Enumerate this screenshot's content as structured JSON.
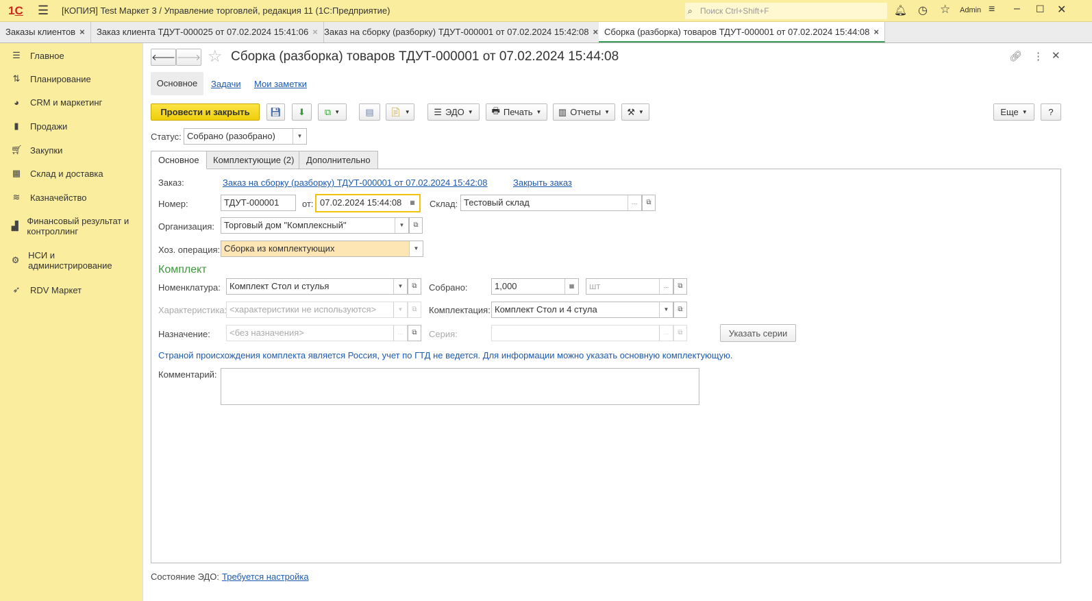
{
  "app": {
    "title": "[КОПИЯ] Test Маркет 3 / Управление торговлей, редакция 11  (1С:Предприятие)",
    "search_placeholder": "Поиск Ctrl+Shift+F",
    "user": "Admin",
    "logo": "1С"
  },
  "window_tabs": [
    {
      "label": "Заказы клиентов"
    },
    {
      "label": "Заказ клиента ТДУТ-000025 от 07.02.2024 15:41:06"
    },
    {
      "label": "Заказ на сборку (разборку) ТДУТ-000001 от 07.02.2024 15:42:08"
    },
    {
      "label": "Сборка (разборка) товаров ТДУТ-000001 от 07.02.2024 15:44:08"
    }
  ],
  "sidebar": {
    "items": [
      {
        "label": "Главное"
      },
      {
        "label": "Планирование"
      },
      {
        "label": "CRM и маркетинг"
      },
      {
        "label": "Продажи"
      },
      {
        "label": "Закупки"
      },
      {
        "label": "Склад и доставка"
      },
      {
        "label": "Казначейство"
      },
      {
        "label": "Финансовый результат и контроллинг"
      },
      {
        "label": "НСИ и администрирование"
      },
      {
        "label": "RDV Маркет"
      }
    ]
  },
  "form": {
    "title": "Сборка (разборка) товаров ТДУТ-000001 от 07.02.2024 15:44:08",
    "nav": [
      "Основное",
      "Задачи",
      "Мои заметки"
    ],
    "toolbar": {
      "post_close": "Провести и закрыть",
      "edo": "ЭДО",
      "print": "Печать",
      "reports": "Отчеты",
      "more": "Еще",
      "help": "?"
    },
    "status_label": "Статус:",
    "status_value": "Собрано (разобрано)",
    "tabs": [
      "Основное",
      "Комплектующие (2)",
      "Дополнительно"
    ],
    "order_label": "Заказ:",
    "order_link": "Заказ на сборку (разборку) ТДУТ-000001 от 07.02.2024 15:42:08",
    "close_order": "Закрыть заказ",
    "number_label": "Номер:",
    "number": "ТДУТ-000001",
    "from_label": "от:",
    "date": "07.02.2024 15:44:08",
    "warehouse_label": "Склад:",
    "warehouse": "Тестовый склад",
    "org_label": "Организация:",
    "org": "Торговый дом \"Комплексный\"",
    "op_label": "Хоз. операция:",
    "op": "Сборка из комплектующих",
    "kit_heading": "Комплект",
    "nom_label": "Номенклатура:",
    "nom": "Комплект Стол и стулья",
    "assembled_label": "Собрано:",
    "assembled": "1,000",
    "unit_placeholder": "шт",
    "char_label": "Характеристика:",
    "char_placeholder": "<характеристики не используются>",
    "config_label": "Комплектация:",
    "config": "Комплект Стол и 4 стула",
    "purpose_label": "Назначение:",
    "purpose_placeholder": "<без назначения>",
    "series_label": "Серия:",
    "series_button": "Указать серии",
    "info": "Страной происхождения комплекта является Россия, учет по ГТД не ведется. Для информации можно указать основную комплектующую.",
    "comment_label": "Комментарий:",
    "comment": "",
    "edo_state_label": "Состояние ЭДО:",
    "edo_state_link": "Требуется настройка"
  }
}
